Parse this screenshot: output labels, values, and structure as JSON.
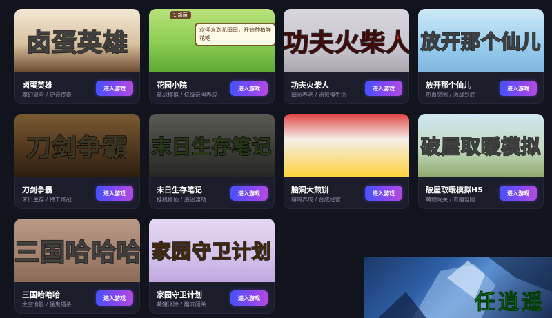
{
  "play_label": "进入游戏",
  "games": [
    {
      "name": "卤蛋英雄",
      "tags": "魔幻冒险 / 史诗传奇",
      "thumb_text": "卤蛋英雄",
      "thumb_text_color": "#ffffff",
      "bg": "linear-gradient(180deg,#f3e7d4 0%,#d9c2a0 55%,#6b4a2e 100%)"
    },
    {
      "name": "花园小院",
      "tags": "商战模拟 / 亿级帝国养成",
      "thumb_text": "",
      "thumb_text_color": "#ffffff",
      "bg": "linear-gradient(180deg,#b9e17b 0%,#8fcf54 50%,#5da934 100%)",
      "bubble": "欢迎来到花田田，开始种植鲜花吧",
      "badge": "1 新萌"
    },
    {
      "name": "功夫火柴人",
      "tags": "田园养老 / 治愈慢生活",
      "thumb_text": "功夫火柴人",
      "thumb_text_color": "#ff2a2a",
      "bg": "linear-gradient(180deg,#d8d5dd 0%,#c9c6cf 60%,#a9a5ad 100%)"
    },
    {
      "name": "放开那个仙儿",
      "tags": "热血突围 / 激战到底",
      "thumb_text": "放开那个仙儿",
      "thumb_text_color": "#ffffff",
      "bg": "linear-gradient(180deg,#cfe9f7 0%,#9ccfee 55%,#7fb5df 100%)"
    },
    {
      "name": "刀剑争霸",
      "tags": "末日生存 / 特工炫战",
      "thumb_text": "刀剑争霸",
      "thumb_text_color": "#e9d28a",
      "bg": "linear-gradient(180deg,#7a5a33 0%,#4d351c 60%,#2d1d0e 100%)"
    },
    {
      "name": "末日生存笔记",
      "tags": "挂机修仙 / 逍遥渡劫",
      "thumb_text": "末日生存笔记",
      "thumb_text_color": "#9de05a",
      "bg": "linear-gradient(180deg,#5a5a55 0%,#3a3a36 60%,#262624 100%)"
    },
    {
      "name": "脑洞大煎饼",
      "tags": "萌鸟养成 / 合成经营",
      "thumb_text": "",
      "thumb_text_color": "#ffffff",
      "bg": "linear-gradient(180deg,#e04545 0%,#f4efe9 40%,#ffd23a 100%)"
    },
    {
      "name": "破屋取暖模拟H5",
      "tags": "萌物闯关 / 奇趣冒险",
      "thumb_text": "破屋取暖模拟",
      "thumb_text_color": "#ffffff",
      "bg": "linear-gradient(180deg,#cfe7f1 0%,#c3d9c2 55%,#8fa96a 100%)"
    },
    {
      "name": "三国哈哈哈",
      "tags": "太空诡影 / 猛鬼猎杀",
      "thumb_text": "三国哈哈哈",
      "thumb_text_color": "#ffffff",
      "bg": "linear-gradient(180deg,#b99a86 0%,#a1806c 60%,#8a6a57 100%)"
    },
    {
      "name": "家园守卫计划",
      "tags": "萌猪消除 / 趣味闯关",
      "thumb_text": "家园守卫计划",
      "thumb_text_color": "#ff9a1f",
      "bg": "linear-gradient(180deg,#e6d8f3 0%,#d3c2ea 60%,#bfa7df 100%)"
    }
  ],
  "ad": {
    "logo": "任逍遥"
  }
}
